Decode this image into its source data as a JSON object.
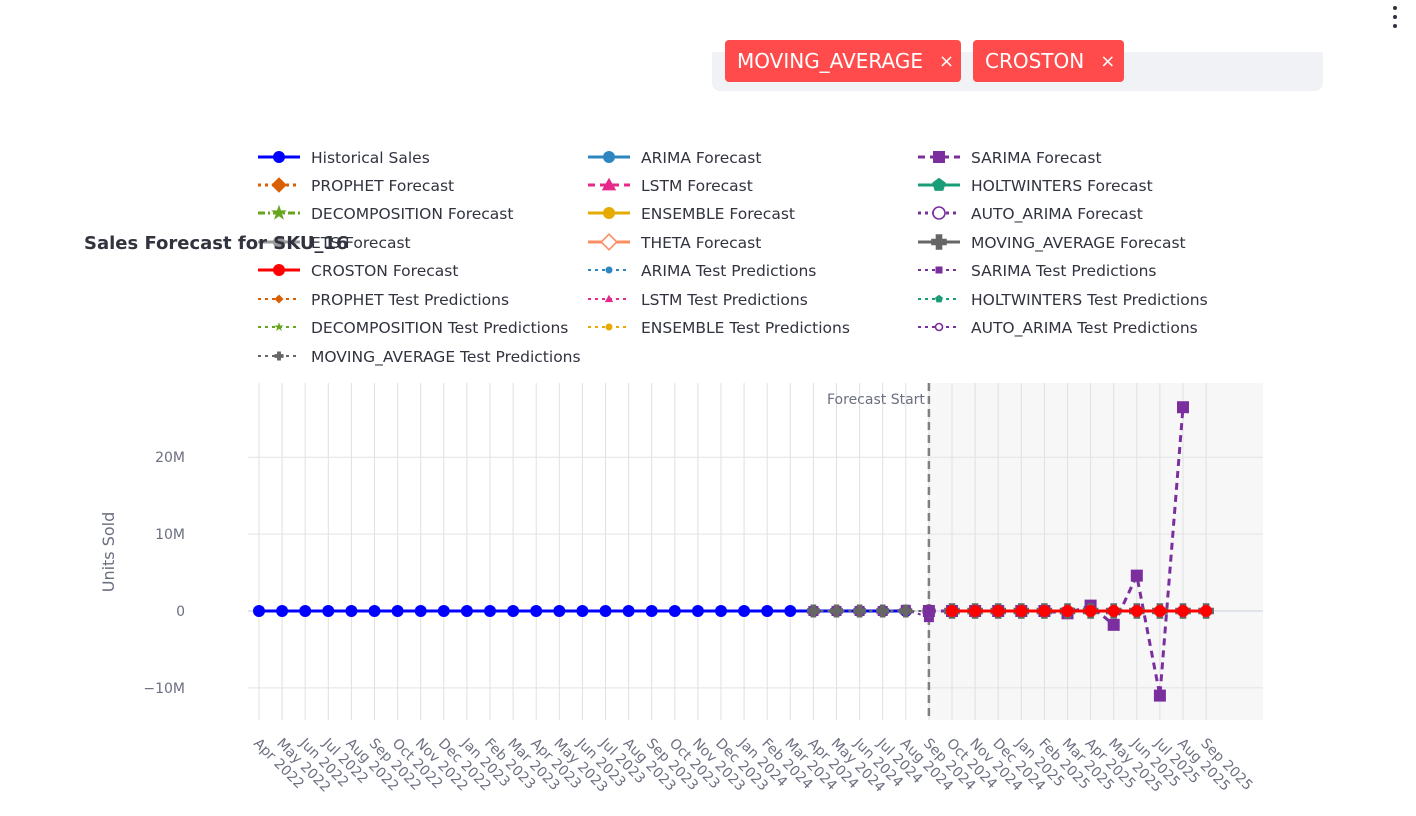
{
  "selected_tags": [
    "MOVING_AVERAGE",
    "CROSTON"
  ],
  "tag_remove_glyph": "×",
  "colors": {
    "tag_bg": "#ff4b4b",
    "historical": "#0000ff",
    "croston": "#ff0000",
    "sarima": "#7b2f9e",
    "moving_average": "#666666",
    "forecast_shade": "#f7f7f7",
    "forecast_line": "#808080"
  },
  "chart_data": {
    "type": "line",
    "title": "Sales Forecast for SKU_16",
    "ylabel": "Units Sold",
    "xlabel": "",
    "ylim": [
      -13000000,
      30000000
    ],
    "yticks": [
      -10000000,
      0,
      10000000,
      20000000
    ],
    "ytick_labels": [
      "−10M",
      "0",
      "10M",
      "20M"
    ],
    "x_categories": [
      "Apr 2022",
      "May 2022",
      "Jun 2022",
      "Jul 2022",
      "Aug 2022",
      "Sep 2022",
      "Oct 2022",
      "Nov 2022",
      "Dec 2022",
      "Jan 2023",
      "Feb 2023",
      "Mar 2023",
      "Apr 2023",
      "May 2023",
      "Jun 2023",
      "Jul 2023",
      "Aug 2023",
      "Sep 2023",
      "Oct 2023",
      "Nov 2023",
      "Dec 2023",
      "Jan 2024",
      "Feb 2024",
      "Mar 2024",
      "Apr 2024",
      "May 2024",
      "Jun 2024",
      "Jul 2024",
      "Aug 2024",
      "Sep 2024",
      "Oct 2024",
      "Nov 2024",
      "Dec 2024",
      "Jan 2025",
      "Feb 2025",
      "Mar 2025",
      "Apr 2025",
      "May 2025",
      "Jun 2025",
      "Jul 2025",
      "Aug 2025",
      "Sep 2025"
    ],
    "forecast_start": "Sep 2024",
    "forecast_start_label": "Forecast Start",
    "grid": true,
    "legend_position": "top",
    "legend": [
      {
        "name": "Historical Sales",
        "color": "#0000ff",
        "dash": "solid",
        "symbol": "circle"
      },
      {
        "name": "ARIMA Forecast",
        "color": "#2e86c1",
        "dash": "solid",
        "symbol": "circle"
      },
      {
        "name": "SARIMA Forecast",
        "color": "#7b2f9e",
        "dash": "dash",
        "symbol": "square"
      },
      {
        "name": "PROPHET Forecast",
        "color": "#d95f02",
        "dash": "dot",
        "symbol": "diamond"
      },
      {
        "name": "LSTM Forecast",
        "color": "#e7298a",
        "dash": "dash",
        "symbol": "triangle"
      },
      {
        "name": "HOLTWINTERS Forecast",
        "color": "#1b9e77",
        "dash": "solid",
        "symbol": "pentagon"
      },
      {
        "name": "DECOMPOSITION Forecast",
        "color": "#66a61e",
        "dash": "dashdot",
        "symbol": "star"
      },
      {
        "name": "ENSEMBLE Forecast",
        "color": "#e6ab02",
        "dash": "solid",
        "symbol": "circle"
      },
      {
        "name": "AUTO_ARIMA Forecast",
        "color": "#7b2f9e",
        "dash": "dot",
        "symbol": "circle-open"
      },
      {
        "name": "ETS Forecast",
        "color": "#999999",
        "dash": "solid",
        "symbol": "circle"
      },
      {
        "name": "THETA Forecast",
        "color": "#fc8d62",
        "dash": "solid",
        "symbol": "diamond-open"
      },
      {
        "name": "MOVING_AVERAGE Forecast",
        "color": "#666666",
        "dash": "solid",
        "symbol": "cross"
      },
      {
        "name": "CROSTON Forecast",
        "color": "#ff0000",
        "dash": "solid",
        "symbol": "circle"
      },
      {
        "name": "ARIMA Test Predictions",
        "color": "#2e86c1",
        "dash": "dot",
        "symbol": "circle-small"
      },
      {
        "name": "SARIMA Test Predictions",
        "color": "#7b2f9e",
        "dash": "dot",
        "symbol": "square-small"
      },
      {
        "name": "PROPHET Test Predictions",
        "color": "#d95f02",
        "dash": "dot",
        "symbol": "diamond-small"
      },
      {
        "name": "LSTM Test Predictions",
        "color": "#e7298a",
        "dash": "dot",
        "symbol": "triangle-small"
      },
      {
        "name": "HOLTWINTERS Test Predictions",
        "color": "#1b9e77",
        "dash": "dot",
        "symbol": "pentagon-small"
      },
      {
        "name": "DECOMPOSITION Test Predictions",
        "color": "#66a61e",
        "dash": "dot",
        "symbol": "star-small"
      },
      {
        "name": "ENSEMBLE Test Predictions",
        "color": "#e6ab02",
        "dash": "dot",
        "symbol": "circle-small"
      },
      {
        "name": "AUTO_ARIMA Test Predictions",
        "color": "#7b2f9e",
        "dash": "dot",
        "symbol": "circle-open-small"
      },
      {
        "name": "MOVING_AVERAGE Test Predictions",
        "color": "#666666",
        "dash": "dot",
        "symbol": "cross-small"
      }
    ],
    "series": [
      {
        "name": "Historical Sales",
        "color": "#0000ff",
        "dash": "solid",
        "symbol": "circle",
        "x_start": 0,
        "values": [
          0,
          0,
          0,
          0,
          0,
          0,
          0,
          0,
          0,
          0,
          0,
          0,
          0,
          0,
          0,
          0,
          0,
          0,
          0,
          0,
          0,
          0,
          0,
          0,
          0,
          0,
          0,
          0,
          0
        ]
      },
      {
        "name": "SARIMA Test Predictions",
        "color": "#7b2f9e",
        "dash": "dot",
        "symbol": "square-small",
        "x_start": 24,
        "values": [
          0,
          0,
          0,
          0,
          150000,
          -800000
        ]
      },
      {
        "name": "MOVING_AVERAGE Test Predictions",
        "color": "#666666",
        "dash": "dot",
        "symbol": "cross-small",
        "x_start": 24,
        "values": [
          0,
          0,
          0,
          0,
          0,
          0
        ]
      },
      {
        "name": "SARIMA Forecast",
        "color": "#7b2f9e",
        "dash": "dash",
        "symbol": "square",
        "x_start": 29,
        "values": [
          0,
          0,
          0,
          0,
          0,
          0,
          -300000,
          700000,
          -1800000,
          4600000,
          -11000000,
          26500000
        ]
      },
      {
        "name": "MOVING_AVERAGE Forecast",
        "color": "#666666",
        "dash": "solid",
        "symbol": "cross",
        "x_start": 30,
        "values": [
          0,
          0,
          0,
          0,
          0,
          0,
          0,
          0,
          0,
          0,
          0,
          0
        ]
      },
      {
        "name": "CROSTON Forecast",
        "color": "#ff0000",
        "dash": "solid",
        "symbol": "circle",
        "x_start": 30,
        "values": [
          0,
          0,
          0,
          0,
          0,
          0,
          0,
          0,
          0,
          0,
          0,
          0
        ]
      }
    ]
  }
}
